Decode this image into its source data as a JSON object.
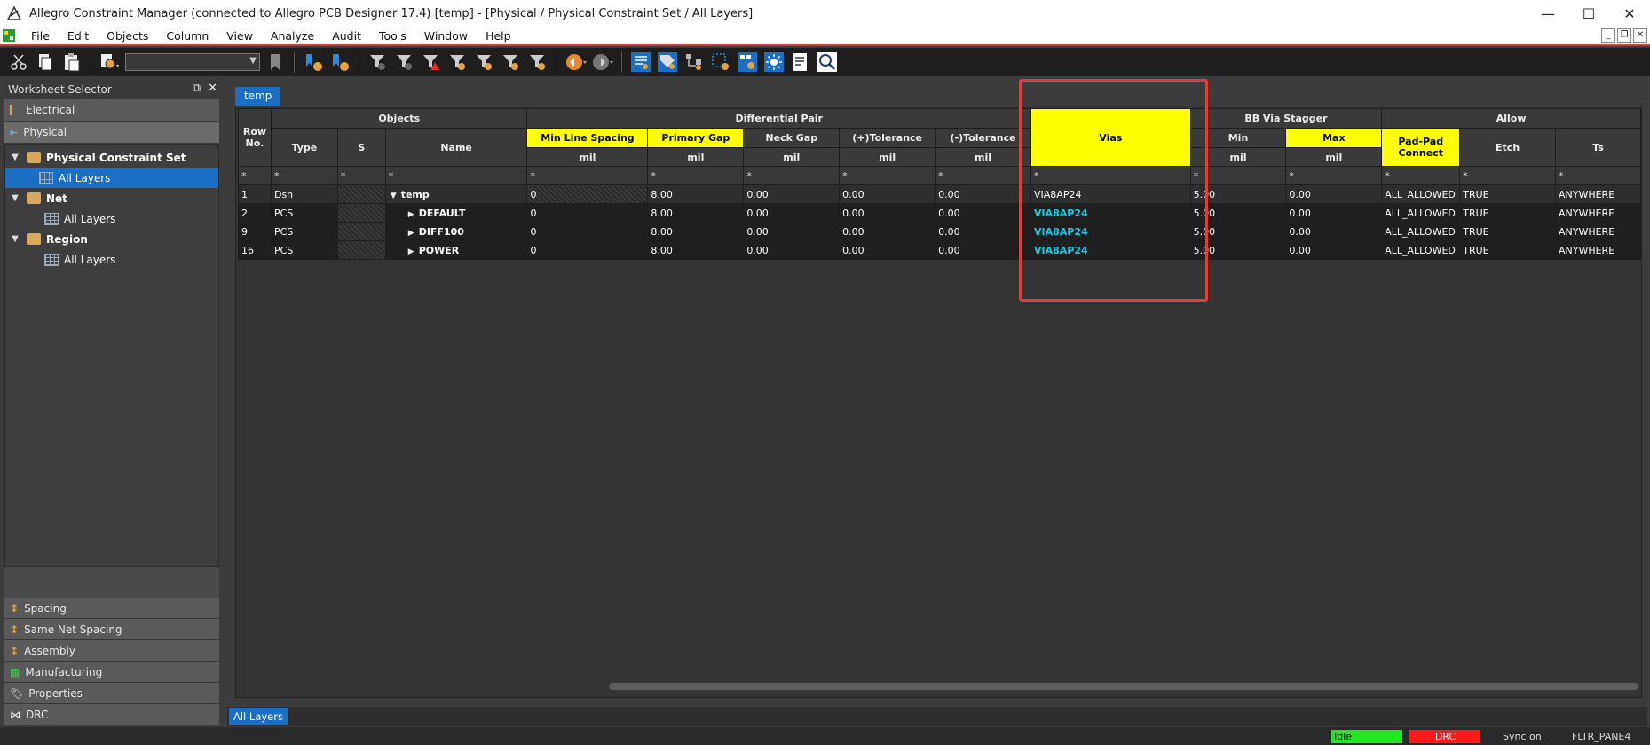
{
  "window": {
    "title": "Allegro Constraint Manager (connected to Allegro PCB Designer 17.4) [temp] - [Physical / Physical Constraint Set / All Layers]",
    "minimize": "—",
    "maximize": "☐",
    "close": "✕"
  },
  "menu": {
    "items": [
      "File",
      "Edit",
      "Objects",
      "Column",
      "View",
      "Analyze",
      "Audit",
      "Tools",
      "Window",
      "Help"
    ],
    "mdi_min": "_",
    "mdi_restore": "❐",
    "mdi_close": "✕"
  },
  "worksheet_selector": {
    "title": "Worksheet Selector",
    "top_categories": [
      "Electrical",
      "Physical"
    ],
    "tree": [
      {
        "label": "Physical Constraint Set",
        "level": 0,
        "bold": true
      },
      {
        "label": "All Layers",
        "level": 1,
        "selected": true
      },
      {
        "label": "Net",
        "level": 0,
        "bold": true
      },
      {
        "label": "All Layers",
        "level": 1
      },
      {
        "label": "Region",
        "level": 0,
        "bold": true
      },
      {
        "label": "All Layers",
        "level": 1
      }
    ],
    "bottom_categories": [
      "Spacing",
      "Same Net Spacing",
      "Assembly",
      "Manufacturing",
      "Properties",
      "DRC"
    ]
  },
  "doc_tab": "temp",
  "grid": {
    "groups": {
      "row_no": "Row No.",
      "objects": "Objects",
      "diff_pair": "Differential Pair",
      "vias": "Vias",
      "bb_via_stagger": "BB Via Stagger",
      "allow": "Allow"
    },
    "columns": {
      "type": "Type",
      "s": "S",
      "name": "Name",
      "min_line_spacing": "Min Line Spacing",
      "primary_gap": "Primary Gap",
      "neck_gap": "Neck Gap",
      "plus_tol": "(+)Tolerance",
      "minus_tol": "(-)Tolerance",
      "bb_min": "Min",
      "bb_max": "Max",
      "pad_pad": "Pad-Pad Connect",
      "etch": "Etch",
      "ts": "Ts"
    },
    "unit": "mil",
    "filter": "*",
    "rows": [
      {
        "row": "1",
        "type": "Dsn",
        "name": "temp",
        "mls": "0",
        "pg": "8.00",
        "ng": "0.00",
        "pt": "0.00",
        "mt": "0.00",
        "vias": "VIA8AP24",
        "bbmin": "5.00",
        "bbmax": "0.00",
        "pad": "ALL_ALLOWED",
        "etch": "TRUE",
        "ts": "ANYWHERE"
      },
      {
        "row": "2",
        "type": "PCS",
        "name": "DEFAULT",
        "mls": "0",
        "pg": "8.00",
        "ng": "0.00",
        "pt": "0.00",
        "mt": "0.00",
        "vias": "VIA8AP24",
        "bbmin": "5.00",
        "bbmax": "0.00",
        "pad": "ALL_ALLOWED",
        "etch": "TRUE",
        "ts": "ANYWHERE"
      },
      {
        "row": "9",
        "type": "PCS",
        "name": "DIFF100",
        "mls": "0",
        "pg": "8.00",
        "ng": "0.00",
        "pt": "0.00",
        "mt": "0.00",
        "vias": "VIA8AP24",
        "bbmin": "5.00",
        "bbmax": "0.00",
        "pad": "ALL_ALLOWED",
        "etch": "TRUE",
        "ts": "ANYWHERE"
      },
      {
        "row": "16",
        "type": "PCS",
        "name": "POWER",
        "mls": "0",
        "pg": "8.00",
        "ng": "0.00",
        "pt": "0.00",
        "mt": "0.00",
        "vias": "VIA8AP24",
        "bbmin": "5.00",
        "bbmax": "0.00",
        "pad": "ALL_ALLOWED",
        "etch": "TRUE",
        "ts": "ANYWHERE"
      }
    ]
  },
  "bottom_tab": "All Layers",
  "status": {
    "idle": "Idle",
    "drc": "DRC",
    "sync": "Sync on.",
    "pane": "FLTR_PANE4"
  },
  "colors": {
    "accent": "#1a6fc4",
    "highlight_header": "#ffff00",
    "via_link": "#19c8e6",
    "annotation_box": "#e83a3a"
  }
}
